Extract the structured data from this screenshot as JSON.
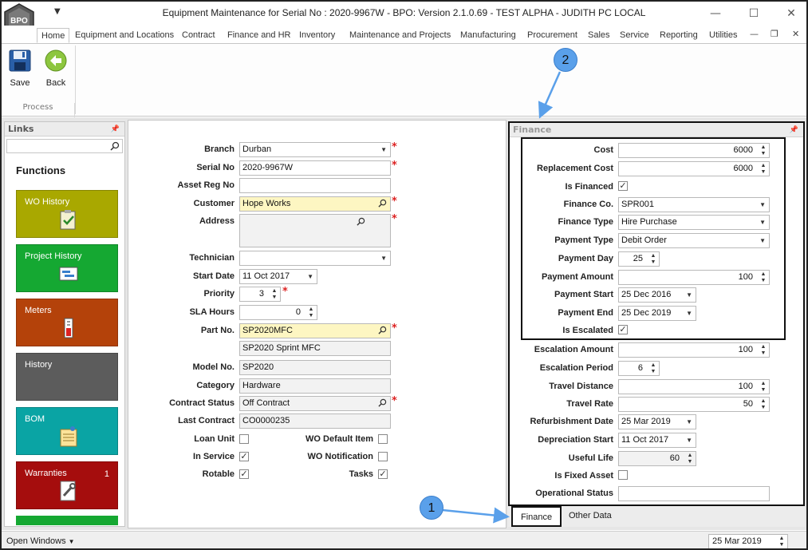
{
  "window": {
    "title": "Equipment Maintenance for Serial No : 2020-9967W - BPO: Version 2.1.0.69 - TEST ALPHA - JUDITH PC LOCAL",
    "logo_text": "BPO"
  },
  "ribbon": {
    "tabs": [
      "Home",
      "Equipment and Locations",
      "Contract",
      "Finance and HR",
      "Inventory",
      "Maintenance and Projects",
      "Manufacturing",
      "Procurement",
      "Sales",
      "Service",
      "Reporting",
      "Utilities"
    ],
    "save_label": "Save",
    "back_label": "Back",
    "group_label": "Process"
  },
  "links": {
    "title": "Links",
    "functions_title": "Functions",
    "tiles": [
      {
        "label": "WO History",
        "color": "#a9a800"
      },
      {
        "label": "Project History",
        "color": "#15a832"
      },
      {
        "label": "Meters",
        "color": "#b4420a"
      },
      {
        "label": "History",
        "color": "#5c5c5c"
      },
      {
        "label": "BOM",
        "color": "#0aa4a4"
      },
      {
        "label": "Warranties",
        "color": "#a50d0d",
        "count": "1"
      }
    ]
  },
  "form": {
    "labels": {
      "branch": "Branch",
      "serial": "Serial No",
      "asset": "Asset Reg No",
      "customer": "Customer",
      "address": "Address",
      "technician": "Technician",
      "start_date": "Start Date",
      "priority": "Priority",
      "sla": "SLA Hours",
      "part": "Part No.",
      "model": "Model No.",
      "category": "Category",
      "contract_status": "Contract Status",
      "last_contract": "Last Contract",
      "loan_unit": "Loan Unit",
      "in_service": "In Service",
      "rotable": "Rotable",
      "wo_default": "WO Default Item",
      "wo_notification": "WO Notification",
      "tasks": "Tasks"
    },
    "values": {
      "branch": "Durban",
      "serial": "2020-9967W",
      "asset": "",
      "customer": "Hope Works",
      "address": "",
      "technician": "",
      "start_date": "11 Oct 2017",
      "priority": "3",
      "sla": "0",
      "part": "SP2020MFC",
      "part_desc": "SP2020 Sprint MFC",
      "model": "SP2020",
      "category": "Hardware",
      "contract_status": "Off Contract",
      "last_contract": "CO0000235"
    }
  },
  "finance": {
    "title": "Finance",
    "labels": {
      "cost": "Cost",
      "replacement_cost": "Replacement Cost",
      "is_financed": "Is Financed",
      "finance_co": "Finance Co.",
      "finance_type": "Finance Type",
      "payment_type": "Payment Type",
      "payment_day": "Payment Day",
      "payment_amount": "Payment Amount",
      "payment_start": "Payment Start",
      "payment_end": "Payment End",
      "is_escalated": "Is Escalated",
      "escalation_amount": "Escalation Amount",
      "escalation_period": "Escalation Period",
      "travel_distance": "Travel Distance",
      "travel_rate": "Travel Rate",
      "refurb_date": "Refurbishment Date",
      "depr_start": "Depreciation Start",
      "useful_life": "Useful Life",
      "is_fixed_asset": "Is Fixed Asset",
      "operational_status": "Operational Status"
    },
    "values": {
      "cost": "6000",
      "replacement_cost": "6000",
      "finance_co": "SPR001",
      "finance_type": "Hire Purchase",
      "payment_type": "Debit Order",
      "payment_day": "25",
      "payment_amount": "100",
      "payment_start": "25 Dec 2016",
      "payment_end": "25 Dec 2019",
      "escalation_amount": "100",
      "escalation_period": "6",
      "travel_distance": "100",
      "travel_rate": "50",
      "refurb_date": "25 Mar 2019",
      "depr_start": "11 Oct 2017",
      "useful_life": "60",
      "operational_status": ""
    }
  },
  "bottom_tabs": [
    "Finance",
    "Other Data"
  ],
  "status": {
    "open_windows": "Open Windows",
    "date": "25 Mar 2019"
  },
  "callouts": [
    "1",
    "2"
  ]
}
